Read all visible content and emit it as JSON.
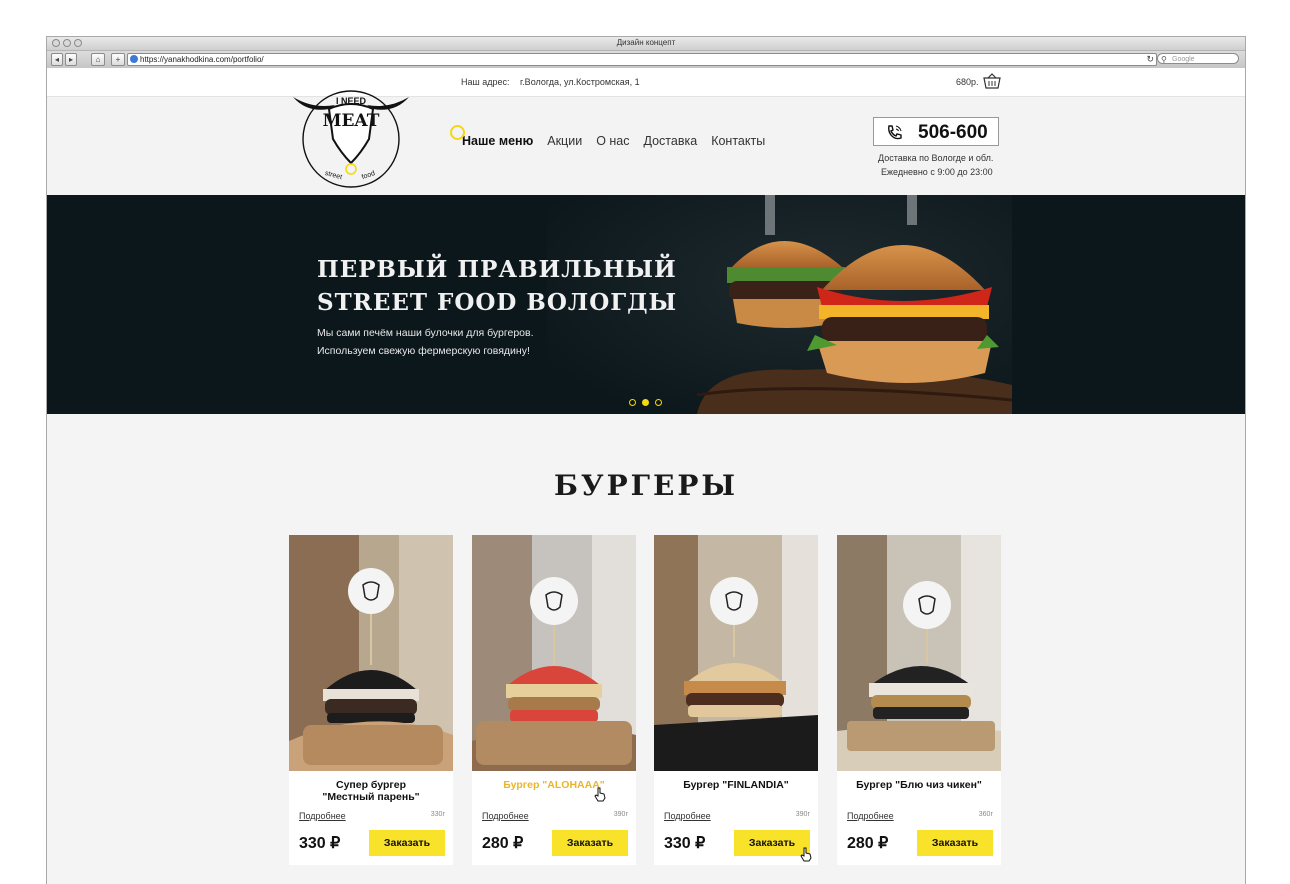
{
  "browser": {
    "window_title": "Дизайн концепт",
    "url": "https://yanakhodkina.com/portfolio/",
    "search_placeholder": "Google"
  },
  "topbar": {
    "address_label": "Наш адрес:",
    "address_value": "г.Вологда, ул.Костромская, 1",
    "cart_total": "680р."
  },
  "logo": {
    "line1": "I NEED",
    "line2": "MEAT",
    "line3": "street",
    "line4": "food"
  },
  "nav": {
    "items": [
      "Наше меню",
      "Акции",
      "О нас",
      "Доставка",
      "Контакты"
    ],
    "active": "Наше меню"
  },
  "contact": {
    "phone": "506-600",
    "delivery_line1": "Доставка по Вологде и обл.",
    "delivery_line2": "Ежедневно с 9:00 до 23:00"
  },
  "hero": {
    "title_line1": "ПЕРВЫЙ ПРАВИЛЬНЫЙ",
    "title_line2": "STREET FOOD ВОЛОГДЫ",
    "subtitle_line1": "Мы сами печём наши булочки для бургеров.",
    "subtitle_line2": "Используем свежую фермерскую говядину!",
    "slides": 3,
    "active_slide": 2
  },
  "section": {
    "title": "БУРГЕРЫ"
  },
  "colors": {
    "accent": "#f9e22a",
    "highlight_text": "#e9b52b",
    "hero_bg": "#0c171c",
    "page_bg": "#f3f3f3"
  },
  "products": [
    {
      "name": "Супер бургер",
      "name2": "\"Местный парень\"",
      "more": "Подробнее",
      "weight": "330г",
      "price": "330 ₽",
      "button": "Заказать",
      "bun": "black"
    },
    {
      "name": "Бургер \"ALOHAAA\"",
      "name2": "",
      "more": "Подробнее",
      "weight": "390г",
      "price": "280 ₽",
      "button": "Заказать",
      "bun": "red"
    },
    {
      "name": "Бургер \"FINLANDIA\"",
      "name2": "",
      "more": "Подробнее",
      "weight": "390г",
      "price": "330 ₽",
      "button": "Заказать",
      "bun": "beige"
    },
    {
      "name": "Бургер \"Блю чиз чикен\"",
      "name2": "",
      "more": "Подробнее",
      "weight": "360г",
      "price": "280 ₽",
      "button": "Заказать",
      "bun": "black"
    }
  ]
}
